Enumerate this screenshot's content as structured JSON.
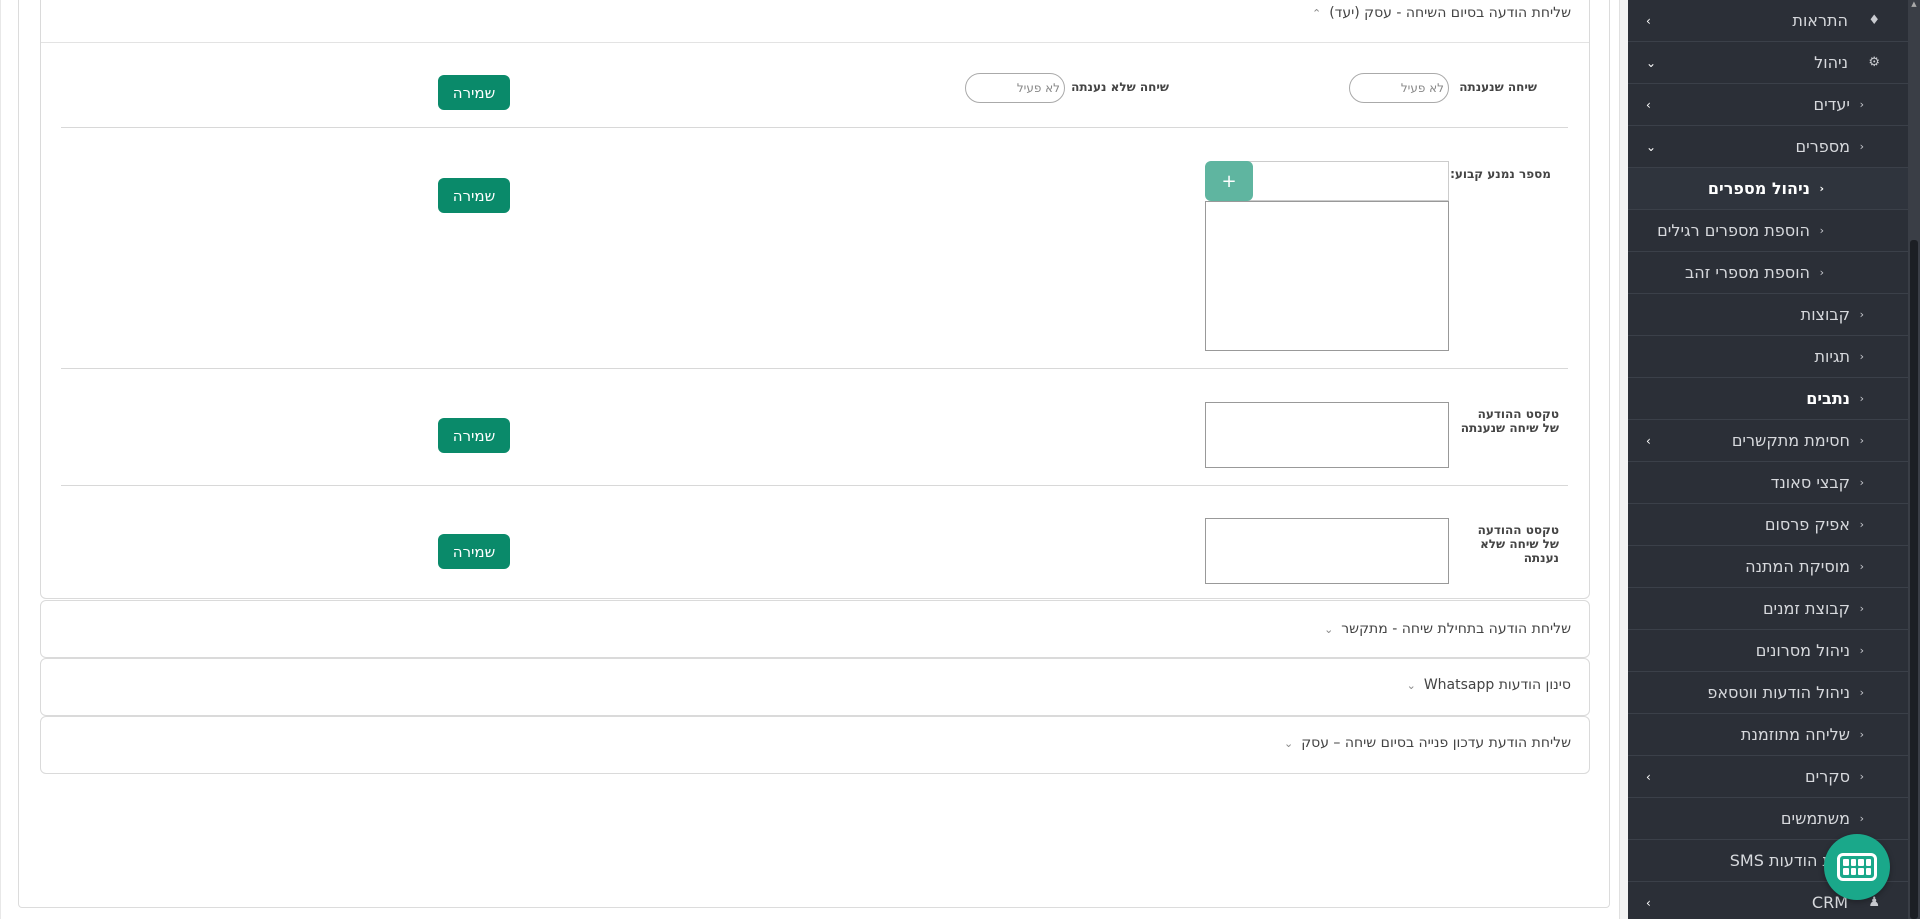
{
  "main": {
    "open_section": {
      "title": "שליחת הודעה בסיום השיחה - עסק (יעד)",
      "row1": {
        "answered_label": "שיחה שנענתה",
        "answered_toggle": "לא פעיל",
        "unanswered_label": "שיחה שלא נענתה",
        "unanswered_toggle": "לא פעיל",
        "save_label": "שמירה"
      },
      "row2": {
        "blocked_label": "מספר נמנע קבוע:",
        "add_label": "+",
        "save_label": "שמירה"
      },
      "row3": {
        "label": "טקסט ההודעה של שיחה שנענתה",
        "save_label": "שמירה"
      },
      "row4": {
        "label": "טקסט ההודעה של שיחה שלא נענתה",
        "save_label": "שמירה"
      }
    },
    "closed_sections": [
      {
        "title": "שליחת הודעה בתחילת שיחה - מתקשר"
      },
      {
        "title": "סינון הודעות Whatsapp"
      },
      {
        "title": "שליחת הודעת עדכון פנייה בסיום שיחה – עסק"
      }
    ]
  },
  "sidebar": {
    "items": [
      {
        "label": "התראות"
      },
      {
        "label": "ניהול"
      },
      {
        "label": "יעדים"
      },
      {
        "label": "מספרים"
      },
      {
        "label": "ניהול מספרים"
      },
      {
        "label": "הוספת מספרים רגילים"
      },
      {
        "label": "הוספת מספרי זהב"
      },
      {
        "label": "קבוצות"
      },
      {
        "label": "תגיות"
      },
      {
        "label": "נתבים"
      },
      {
        "label": "חסימת מתקשרים"
      },
      {
        "label": "קבצי סאונד"
      },
      {
        "label": "אפיק פרסום"
      },
      {
        "label": "מוסיקת המתנה"
      },
      {
        "label": "קבוצת זמנים"
      },
      {
        "label": "ניהול מסרונים"
      },
      {
        "label": "ניהול הודעות ווטסאפ"
      },
      {
        "label": "שליחה מתוזמנת"
      },
      {
        "label": "סקרים"
      },
      {
        "label": "משתמשים"
      },
      {
        "label": "ת הודעות SMS"
      },
      {
        "label": "CRM"
      }
    ]
  },
  "colors": {
    "save_button": "#0a8a6a",
    "plus_button": "#5fb5a0",
    "sidebar_bg": "#2b2f37",
    "chat_fab": "#1aa88a"
  }
}
